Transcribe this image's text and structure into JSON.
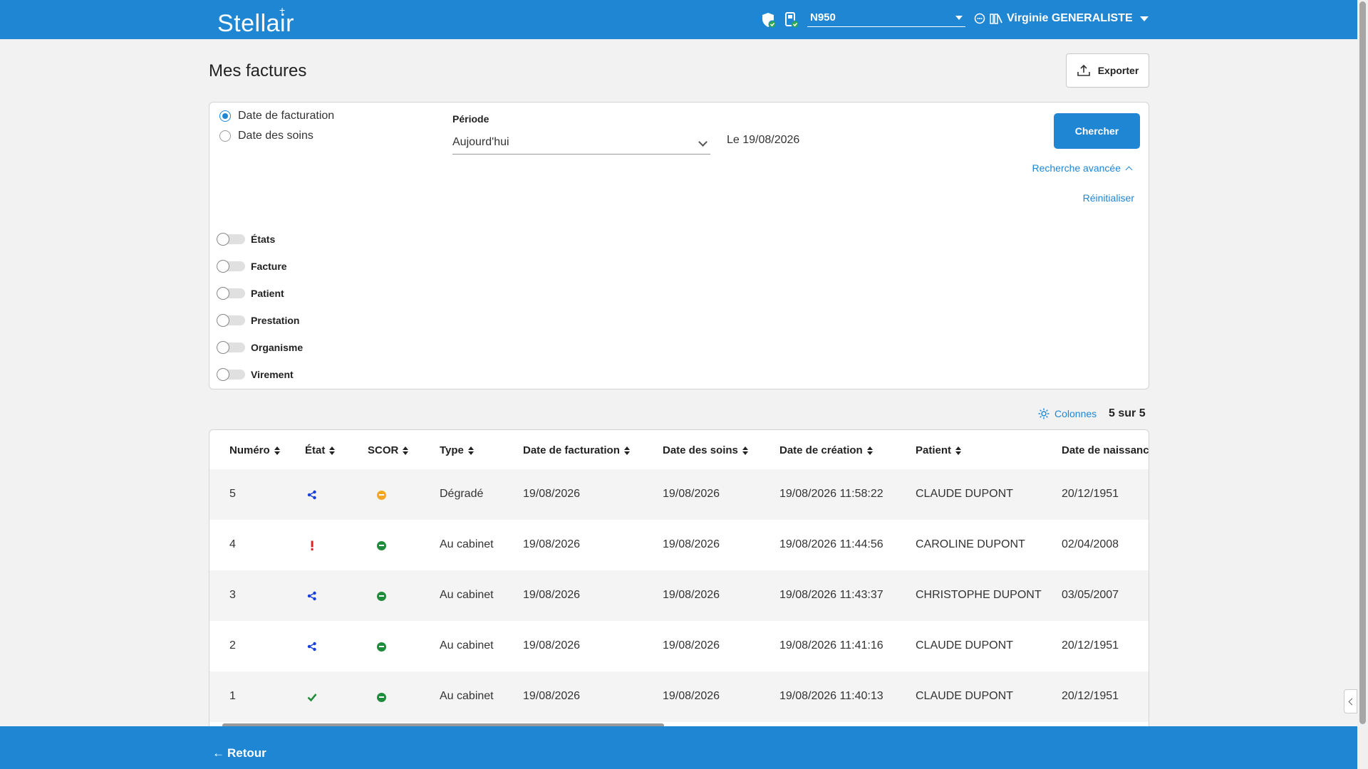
{
  "header": {
    "logo": "Stellair",
    "device": "N950",
    "user": "Virginie GENERALISTE"
  },
  "page": {
    "title": "Mes factures",
    "export_label": "Exporter"
  },
  "filters": {
    "radio_options": [
      {
        "label": "Date de facturation",
        "selected": true
      },
      {
        "label": "Date des soins",
        "selected": false
      }
    ],
    "periode_label": "Période",
    "periode_value": "Aujourd'hui",
    "date_text": "Le 19/08/2026",
    "search_label": "Chercher",
    "advanced_label": "Recherche avancée",
    "reset_label": "Réinitialiser",
    "toggles": [
      "États",
      "Facture",
      "Patient",
      "Prestation",
      "Organisme",
      "Virement"
    ]
  },
  "table_meta": {
    "columns_label": "Colonnes",
    "count": "5 sur 5"
  },
  "table": {
    "headers": [
      "Numéro",
      "État",
      "SCOR",
      "Type",
      "Date de facturation",
      "Date des soins",
      "Date de création",
      "Patient",
      "Date de naissanc"
    ],
    "rows": [
      {
        "numero": "5",
        "etat": "share-icon",
        "scor": "orange",
        "type": "Dégradé",
        "date_fact": "19/08/2026",
        "date_soins": "19/08/2026",
        "date_creation": "19/08/2026 11:58:22",
        "patient": "CLAUDE DUPONT",
        "naissance": "20/12/1951"
      },
      {
        "numero": "4",
        "etat": "warning-icon",
        "scor": "green",
        "type": "Au cabinet",
        "date_fact": "19/08/2026",
        "date_soins": "19/08/2026",
        "date_creation": "19/08/2026 11:44:56",
        "patient": "CAROLINE DUPONT",
        "naissance": "02/04/2008"
      },
      {
        "numero": "3",
        "etat": "share-icon",
        "scor": "green",
        "type": "Au cabinet",
        "date_fact": "19/08/2026",
        "date_soins": "19/08/2026",
        "date_creation": "19/08/2026 11:43:37",
        "patient": "CHRISTOPHE DUPONT",
        "naissance": "03/05/2007"
      },
      {
        "numero": "2",
        "etat": "share-icon",
        "scor": "green",
        "type": "Au cabinet",
        "date_fact": "19/08/2026",
        "date_soins": "19/08/2026",
        "date_creation": "19/08/2026 11:41:16",
        "patient": "CLAUDE DUPONT",
        "naissance": "20/12/1951"
      },
      {
        "numero": "1",
        "etat": "check-icon",
        "scor": "green",
        "type": "Au cabinet",
        "date_fact": "19/08/2026",
        "date_soins": "19/08/2026",
        "date_creation": "19/08/2026 11:40:13",
        "patient": "CLAUDE DUPONT",
        "naissance": "20/12/1951"
      }
    ]
  },
  "footer": {
    "back_label": "Retour"
  },
  "colors": {
    "primary": "#1f86d3",
    "scor_orange": "#f5a623",
    "scor_green": "#1e8c3a",
    "state_blue": "#1a3fd6",
    "state_red": "#e02020",
    "state_green": "#1e8c3a"
  }
}
